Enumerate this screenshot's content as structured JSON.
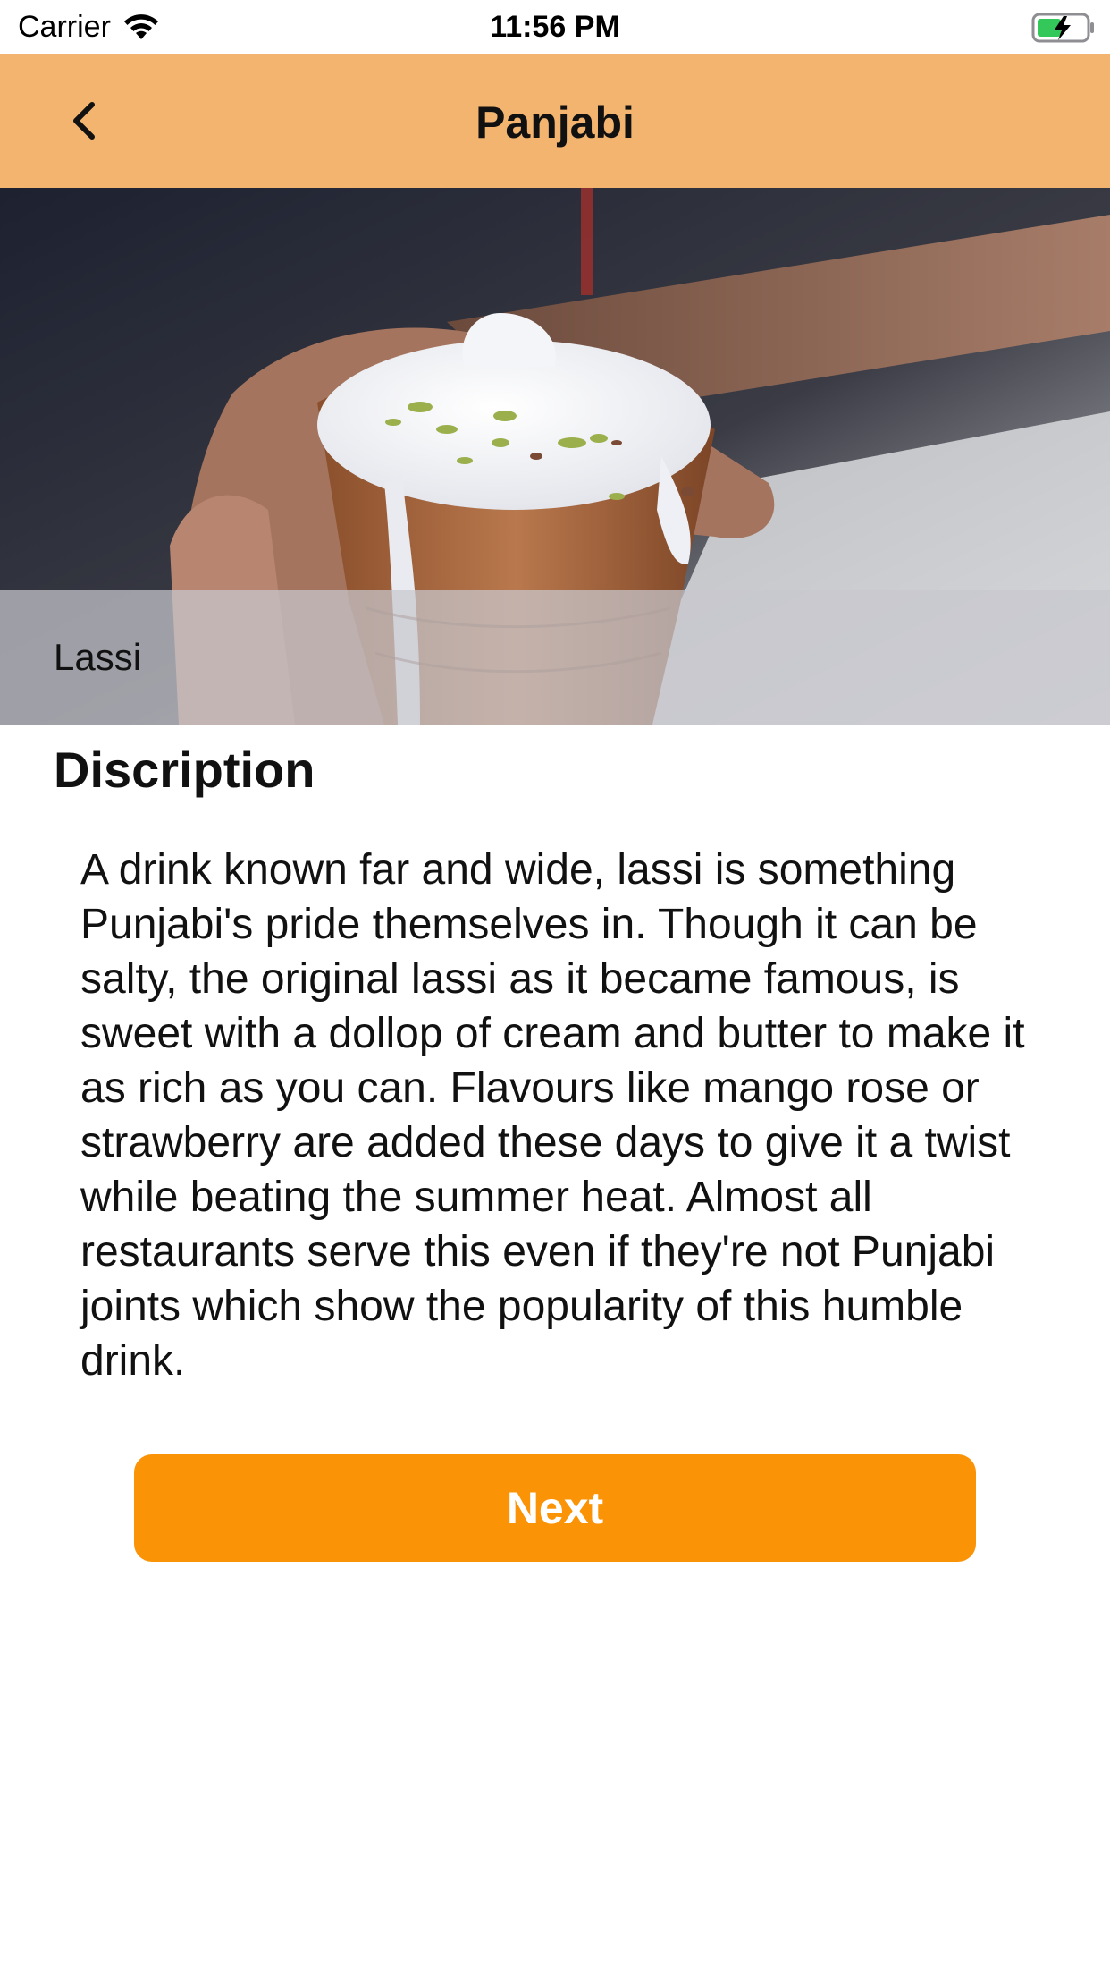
{
  "status_bar": {
    "carrier": "Carrier",
    "time": "11:56 PM",
    "wifi_icon": "wifi-icon",
    "battery_icon": "battery-charging-icon"
  },
  "nav_bar": {
    "title": "Panjabi",
    "back_icon": "chevron-left-icon",
    "background_color": "#f2b46f"
  },
  "hero": {
    "image_subject": "lassi in clay cup",
    "caption": "Lassi"
  },
  "description": {
    "heading": "Discription",
    "text": "A drink known far and wide, lassi is something Punjabi's pride themselves in. Though it can be salty, the original lassi as it became famous, is sweet with a dollop of cream and butter to make it as rich as you can. Flavours like mango rose or strawberry are added these days to give it a twist while beating the summer heat. Almost all restaurants serve this even if they're not Punjabi joints which show the popularity of this humble drink."
  },
  "actions": {
    "next_label": "Next",
    "accent_color": "#fb9307"
  }
}
